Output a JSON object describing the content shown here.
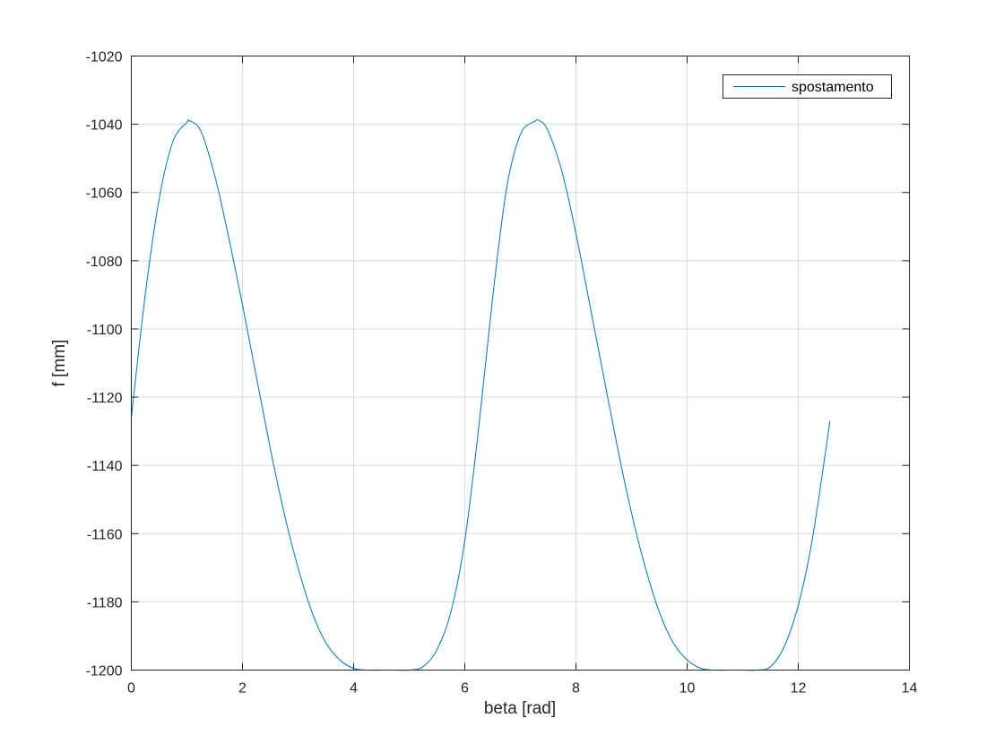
{
  "chart_data": {
    "type": "line",
    "xlabel": "beta [rad]",
    "ylabel": "f [mm]",
    "xlim": [
      0,
      14
    ],
    "ylim": [
      -1200,
      -1020
    ],
    "xticks": [
      0,
      2,
      4,
      6,
      8,
      10,
      12,
      14
    ],
    "yticks": [
      -1020,
      -1040,
      -1060,
      -1080,
      -1100,
      -1120,
      -1140,
      -1160,
      -1180,
      -1200
    ],
    "grid": true,
    "legend_position": "top-right",
    "series": [
      {
        "name": "spostamento",
        "color": "#0072BD",
        "x": [
          0,
          0.25,
          0.5,
          0.75,
          1.0,
          1.05,
          1.25,
          1.5,
          1.75,
          2.0,
          2.25,
          2.5,
          2.75,
          3.0,
          3.25,
          3.5,
          3.75,
          4.0,
          4.25,
          4.5,
          4.75,
          5.0,
          5.25,
          5.5,
          5.75,
          6.0,
          6.25,
          6.5,
          6.75,
          7.0,
          7.25,
          7.35,
          7.5,
          7.75,
          8.0,
          8.25,
          8.5,
          8.75,
          9.0,
          9.25,
          9.5,
          9.75,
          10.0,
          10.25,
          10.5,
          10.75,
          11.0,
          11.25,
          11.5,
          11.75,
          12.0,
          12.25,
          12.57
        ],
        "y": [
          -1126,
          -1090,
          -1062,
          -1045,
          -1039.5,
          -1039,
          -1042,
          -1055,
          -1073,
          -1093,
          -1114,
          -1135,
          -1154,
          -1170,
          -1183,
          -1192,
          -1197,
          -1199.5,
          -1200,
          -1200,
          -1200,
          -1200,
          -1199,
          -1194,
          -1183,
          -1162,
          -1129,
          -1091,
          -1059,
          -1043,
          -1039.2,
          -1039,
          -1042,
          -1054,
          -1072,
          -1093,
          -1114,
          -1135,
          -1154,
          -1170,
          -1183,
          -1192,
          -1197,
          -1199.5,
          -1200,
          -1200,
          -1200,
          -1200,
          -1199,
          -1193,
          -1181,
          -1162,
          -1127
        ]
      }
    ]
  }
}
